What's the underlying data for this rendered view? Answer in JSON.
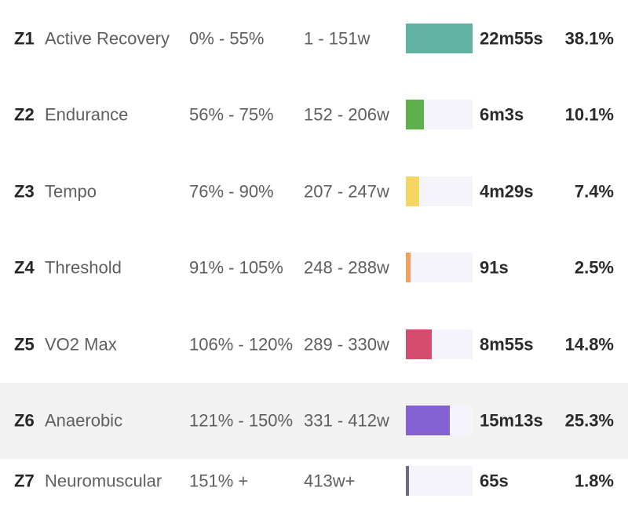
{
  "zones": [
    {
      "zone": "Z1",
      "name": "Active Recovery",
      "range_pct": "0% - 55%",
      "range_watts": "1 - 151w",
      "time": "22m55s",
      "share": "38.1%",
      "share_value": 38.1,
      "color": "#5fb3a0"
    },
    {
      "zone": "Z2",
      "name": "Endurance",
      "range_pct": "56% - 75%",
      "range_watts": "152 - 206w",
      "time": "6m3s",
      "share": "10.1%",
      "share_value": 10.1,
      "color": "#5db04b"
    },
    {
      "zone": "Z3",
      "name": "Tempo",
      "range_pct": "76% - 90%",
      "range_watts": "207 - 247w",
      "time": "4m29s",
      "share": "7.4%",
      "share_value": 7.4,
      "color": "#f6d663"
    },
    {
      "zone": "Z4",
      "name": "Threshold",
      "range_pct": "91% - 105%",
      "range_watts": "248 - 288w",
      "time": "91s",
      "share": "2.5%",
      "share_value": 2.5,
      "color": "#f0a05a"
    },
    {
      "zone": "Z5",
      "name": "VO2 Max",
      "range_pct": "106% - 120%",
      "range_watts": "289 - 330w",
      "time": "8m55s",
      "share": "14.8%",
      "share_value": 14.8,
      "color": "#d44d6e"
    },
    {
      "zone": "Z6",
      "name": "Anaerobic",
      "range_pct": "121% - 150%",
      "range_watts": "331 - 412w",
      "time": "15m13s",
      "share": "25.3%",
      "share_value": 25.3,
      "color": "#8562d3",
      "highlighted": true
    },
    {
      "zone": "Z7",
      "name": "Neuromuscular",
      "range_pct": "151% +",
      "range_watts": "413w+",
      "time": "65s",
      "share": "1.8%",
      "share_value": 1.8,
      "color": "#6e6a80"
    }
  ]
}
